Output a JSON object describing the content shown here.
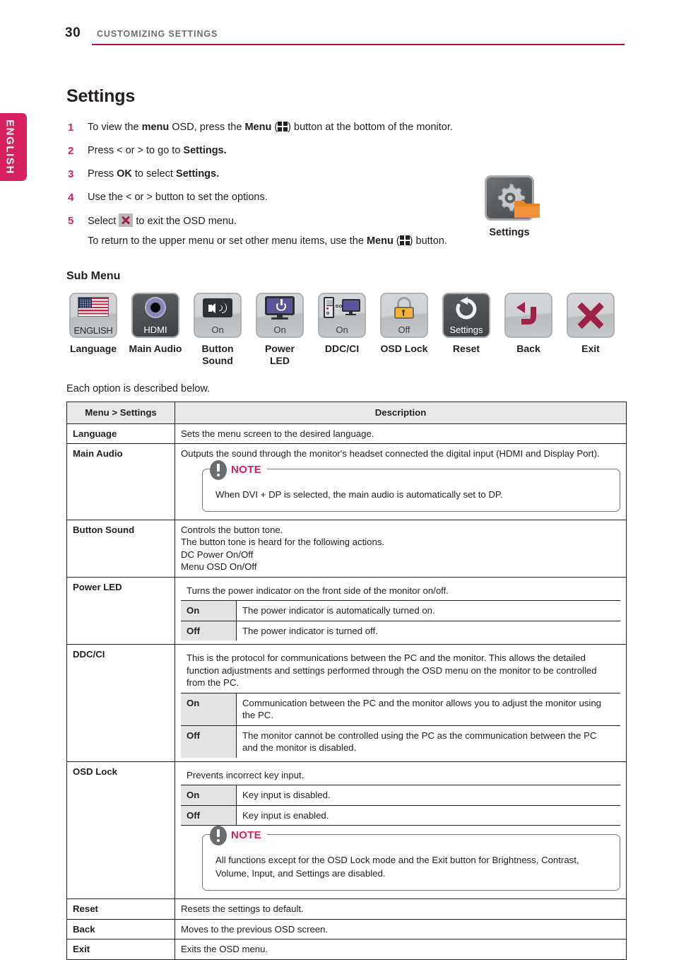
{
  "header": {
    "page_number": "30",
    "chapter": "CUSTOMIZING SETTINGS",
    "rule_color": "#b40a54"
  },
  "side_tab": {
    "label": "ENGLISH",
    "color": "#d81f5f"
  },
  "page_title": "Settings",
  "steps": [
    {
      "num": "1",
      "before": "To view the ",
      "bold1": "menu",
      "mid": " OSD, press the ",
      "bold2": "Menu",
      "icon": "menu-grid-icon",
      "after": ") button at the bottom of the monitor."
    },
    {
      "num": "2",
      "before": "Press < or > to go to ",
      "bold1": "Settings.",
      "mid": "",
      "bold2": "",
      "icon": "",
      "after": ""
    },
    {
      "num": "3",
      "before": "Press ",
      "bold1": "OK",
      "mid": " to select ",
      "bold2": "Settings.",
      "icon": "",
      "after": ""
    },
    {
      "num": "4",
      "before": "Use the < or > button to set the options.",
      "bold1": "",
      "mid": "",
      "bold2": "",
      "icon": "",
      "after": ""
    },
    {
      "num": "5",
      "before": "Select ",
      "bold1": "",
      "mid": "",
      "bold2": "",
      "icon": "x-close-icon",
      "after": " to exit the OSD menu."
    }
  ],
  "substep": {
    "before": "To return to the upper menu or set other menu items, use the ",
    "bold": "Menu",
    "icon": "menu-grid-icon",
    "after": ") button."
  },
  "settings_illustration": {
    "caption": "Settings",
    "icon": "settings-gear-folder-icon"
  },
  "submenu": {
    "title": "Sub Menu",
    "items": [
      {
        "caption": "Language",
        "state": "ENGLISH",
        "icon": "flag-usa-icon",
        "style": "light"
      },
      {
        "caption": "Main Audio",
        "state": "HDMI",
        "icon": "audio-jack-icon",
        "style": "dark"
      },
      {
        "caption": "Button\nSound",
        "state": "On",
        "icon": "speaker-icon",
        "style": "light"
      },
      {
        "caption": "Power\nLED",
        "state": "On",
        "icon": "monitor-power-icon",
        "style": "light"
      },
      {
        "caption": "DDC/CI",
        "state": "On",
        "icon": "pc-monitor-link-icon",
        "style": "light"
      },
      {
        "caption": "OSD Lock",
        "state": "Off",
        "icon": "padlock-icon",
        "style": "light"
      },
      {
        "caption": "Reset",
        "state": "Settings",
        "icon": "reset-arrow-icon",
        "style": "dark"
      },
      {
        "caption": "Back",
        "state": "",
        "icon": "back-arrow-icon",
        "style": "light"
      },
      {
        "caption": "Exit",
        "state": "",
        "icon": "exit-x-icon",
        "style": "light"
      }
    ]
  },
  "each_option_text": "Each option is described below.",
  "table": {
    "headers": {
      "col1": "Menu > Settings",
      "col2": "Description"
    },
    "rows": {
      "language": {
        "label": "Language",
        "desc": "Sets the menu screen to the desired language."
      },
      "main_audio": {
        "label": "Main Audio",
        "desc": "Outputs the sound through the monitor's headset connected the digital input (HDMI and Display Port).",
        "note": {
          "title": "NOTE",
          "body": "When DVI + DP is selected, the main audio is automatically set to DP."
        }
      },
      "button_sound": {
        "label": "Button Sound",
        "line1": "Controls the button tone.",
        "line2": "The button tone is heard for the following actions.",
        "line3": "DC Power On/Off",
        "line4": "Menu OSD On/Off"
      },
      "power_led": {
        "label": "Power LED",
        "desc": "Turns the power indicator on the front side of the monitor on/off.",
        "on_label": "On",
        "on_desc": "The power indicator is automatically turned on.",
        "off_label": "Off",
        "off_desc": "The power indicator is turned off."
      },
      "ddc_ci": {
        "label": "DDC/CI",
        "desc": "This is the protocol for communications between the PC and the monitor. This allows the detailed function adjustments and settings performed through the OSD menu on the monitor to be controlled from the PC.",
        "on_label": "On",
        "on_desc": "Communication between the PC and the monitor allows you to adjust the monitor using the PC.",
        "off_label": "Off",
        "off_desc": "The monitor cannot be controlled using the PC as the communication between the PC and the monitor is disabled."
      },
      "osd_lock": {
        "label": "OSD Lock",
        "desc": "Prevents incorrect key input.",
        "on_label": "On",
        "on_desc": "Key input is disabled.",
        "off_label": "Off",
        "off_desc": "Key input is enabled.",
        "note": {
          "title": "NOTE",
          "body": "All functions except for the OSD Lock mode and the Exit button for Brightness, Contrast, Volume, Input, and Settings are disabled."
        }
      },
      "reset": {
        "label": "Reset",
        "desc": "Resets the settings to default."
      },
      "back": {
        "label": "Back",
        "desc": "Moves to the previous OSD screen."
      },
      "exit": {
        "label": "Exit",
        "desc": "Exits the OSD menu."
      }
    }
  }
}
